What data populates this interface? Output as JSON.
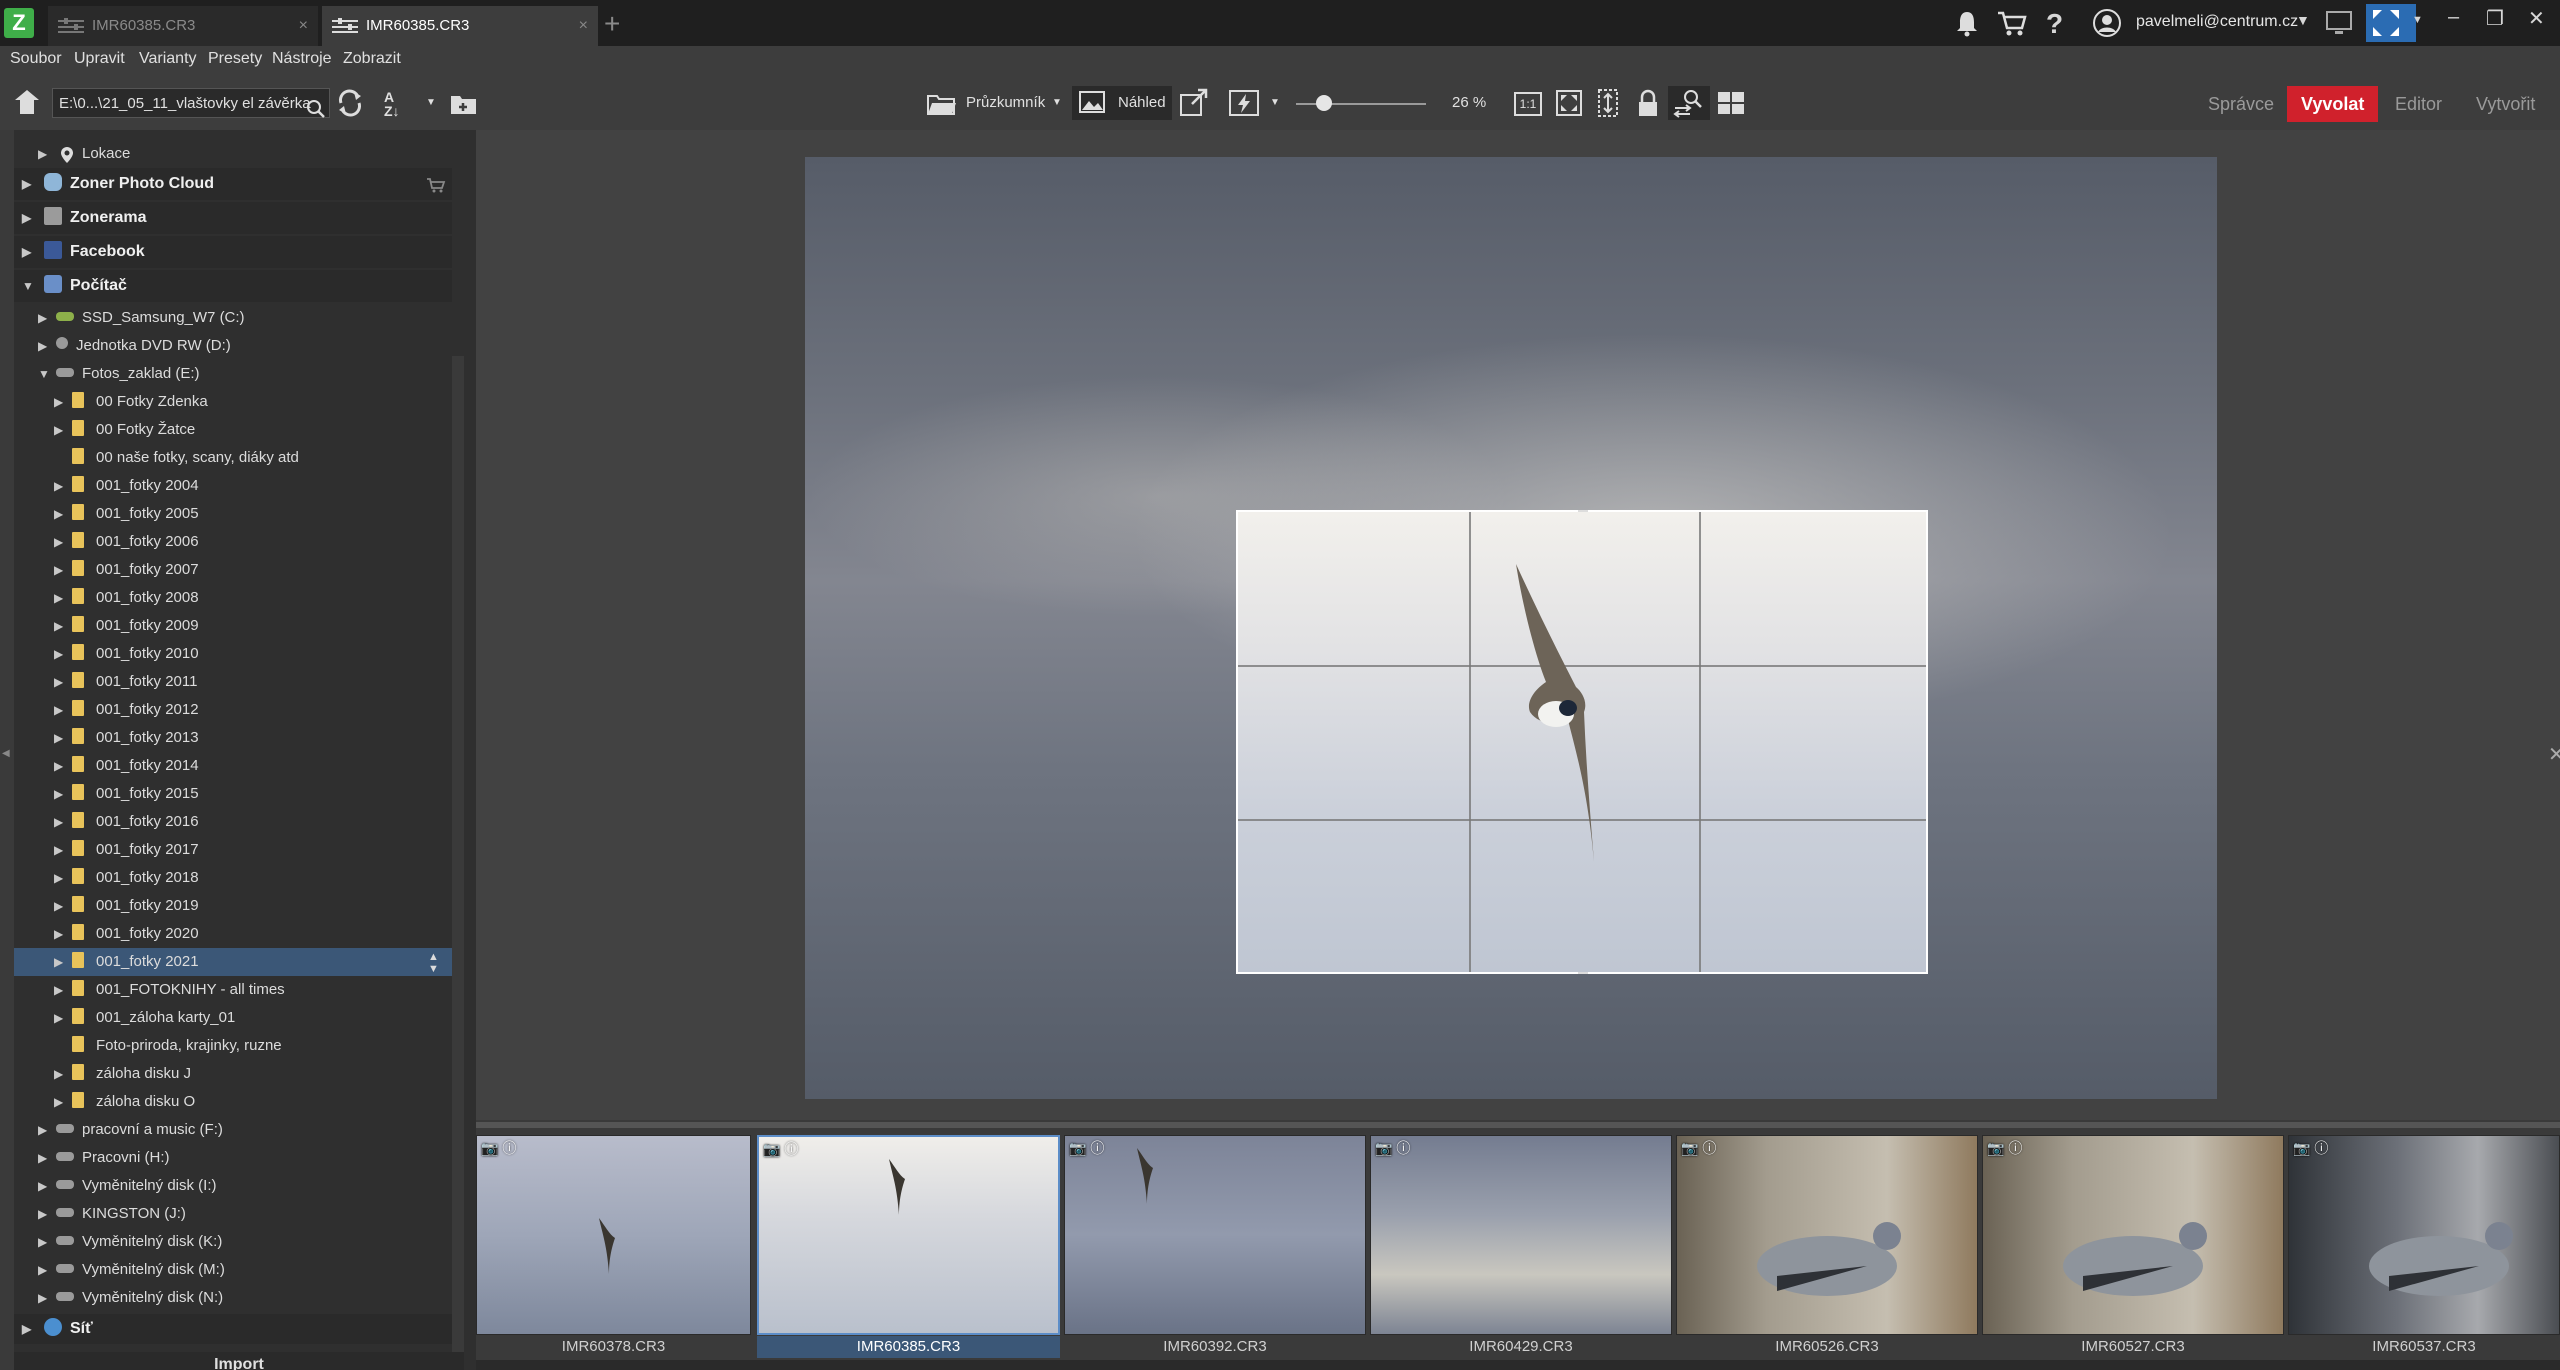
{
  "window": {
    "tabs": [
      {
        "label": "IMR60385.CR3",
        "active": false
      },
      {
        "label": "IMR60385.CR3",
        "active": true
      }
    ],
    "user_email": "pavelmeli@centrum.cz",
    "logo_letter": "Z"
  },
  "menu": [
    "Soubor",
    "Upravit",
    "Varianty",
    "Presety",
    "Nástroje",
    "Zobrazit"
  ],
  "toolbar": {
    "path": "E:\\0...\\21_05_11_vlaštovky el závěrka",
    "explorer_label": "Průzkumník",
    "preview_label": "Náhled",
    "zoom_value": "26 %",
    "one_to_one": "1:1"
  },
  "modes": [
    "Správce",
    "Vyvolat",
    "Editor",
    "Vytvořit"
  ],
  "active_mode": "Vyvolat",
  "tree": {
    "top_items": [
      {
        "label": "Lokace"
      }
    ],
    "sections": [
      {
        "label": "Zoner Photo Cloud"
      },
      {
        "label": "Zonerama"
      },
      {
        "label": "Facebook"
      },
      {
        "label": "Počítač"
      }
    ],
    "drives_top": [
      {
        "label": "SSD_Samsung_W7 (C:)"
      },
      {
        "label": "Jednotka DVD RW (D:)"
      },
      {
        "label": "Fotos_zaklad (E:)"
      }
    ],
    "folders": [
      {
        "label": "00 Fotky Zdenka",
        "arrow": true
      },
      {
        "label": "00 Fotky Žatce",
        "arrow": true
      },
      {
        "label": "00 naše fotky, scany, diáky atd",
        "arrow": false
      },
      {
        "label": "001_fotky 2004",
        "arrow": true
      },
      {
        "label": "001_fotky 2005",
        "arrow": true
      },
      {
        "label": "001_fotky 2006",
        "arrow": true
      },
      {
        "label": "001_fotky 2007",
        "arrow": true
      },
      {
        "label": "001_fotky 2008",
        "arrow": true
      },
      {
        "label": "001_fotky 2009",
        "arrow": true
      },
      {
        "label": "001_fotky 2010",
        "arrow": true
      },
      {
        "label": "001_fotky 2011",
        "arrow": true
      },
      {
        "label": "001_fotky 2012",
        "arrow": true
      },
      {
        "label": "001_fotky 2013",
        "arrow": true
      },
      {
        "label": "001_fotky 2014",
        "arrow": true
      },
      {
        "label": "001_fotky 2015",
        "arrow": true
      },
      {
        "label": "001_fotky 2016",
        "arrow": true
      },
      {
        "label": "001_fotky 2017",
        "arrow": true
      },
      {
        "label": "001_fotky 2018",
        "arrow": true
      },
      {
        "label": "001_fotky 2019",
        "arrow": true
      },
      {
        "label": "001_fotky 2020",
        "arrow": true
      },
      {
        "label": "001_fotky 2021",
        "arrow": true,
        "selected": true
      },
      {
        "label": "001_FOTOKNIHY - all times",
        "arrow": true
      },
      {
        "label": "001_záloha karty_01",
        "arrow": true
      },
      {
        "label": "Foto-priroda, krajinky, ruzne",
        "arrow": false
      },
      {
        "label": "záloha disku J",
        "arrow": true
      },
      {
        "label": "záloha disku O",
        "arrow": true
      }
    ],
    "drives_bottom": [
      {
        "label": "pracovní a music (F:)"
      },
      {
        "label": "Pracovni (H:)"
      },
      {
        "label": "Vyměnitelný disk (I:)"
      },
      {
        "label": "KINGSTON (J:)"
      },
      {
        "label": "Vyměnitelný disk (K:)"
      },
      {
        "label": "Vyměnitelný disk (M:)"
      },
      {
        "label": "Vyměnitelný disk (N:)"
      }
    ],
    "network_label": "Síť",
    "import_label": "Import"
  },
  "filmstrip": [
    {
      "name": "IMR60378.CR3",
      "theme": "sky-bird-small"
    },
    {
      "name": "IMR60385.CR3",
      "theme": "sky-bird",
      "selected": true
    },
    {
      "name": "IMR60392.CR3",
      "theme": "sky-dark-bird"
    },
    {
      "name": "IMR60429.CR3",
      "theme": "sky-sunset"
    },
    {
      "name": "IMR60526.CR3",
      "theme": "pigeon"
    },
    {
      "name": "IMR60527.CR3",
      "theme": "pigeon"
    },
    {
      "name": "IMR60537.CR3",
      "theme": "pigeon-dark"
    }
  ]
}
